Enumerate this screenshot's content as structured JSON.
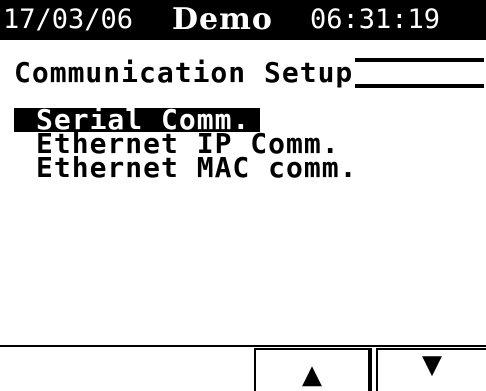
{
  "status_bar": {
    "date": "17/03/06",
    "title": "Demo",
    "time": "06:31:19"
  },
  "heading": "Communication Setup",
  "menu": {
    "items": [
      {
        "label": "Serial Comm.",
        "selected": true
      },
      {
        "label": "Ethernet IP Comm.",
        "selected": false
      },
      {
        "label": "Ethernet MAC comm.",
        "selected": false
      }
    ]
  },
  "softkeys": {
    "up": {
      "icon": "up-arrow-icon",
      "glyph": "▲"
    },
    "down": {
      "icon": "down-arrow-icon",
      "glyph": "▼"
    }
  },
  "colors": {
    "foreground": "#000000",
    "background": "#ffffff"
  }
}
